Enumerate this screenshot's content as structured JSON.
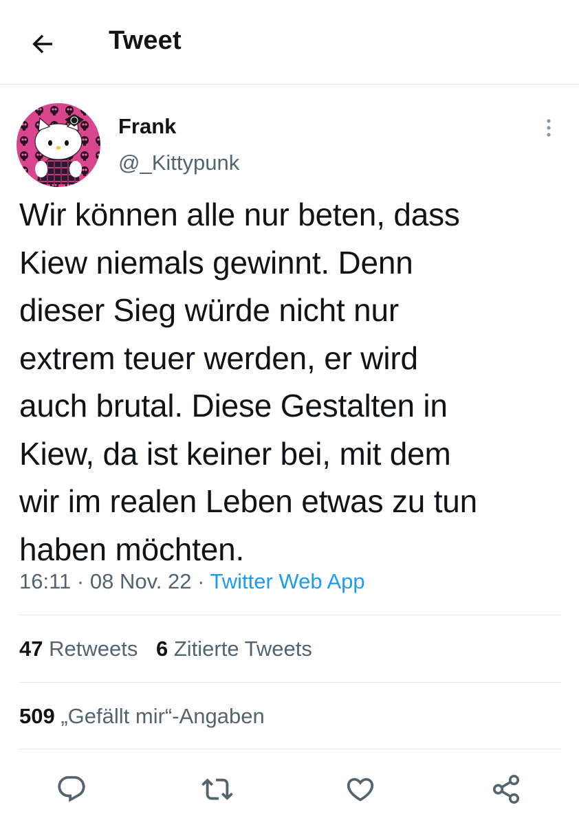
{
  "header": {
    "title": "Tweet",
    "back_icon": "arrow-left-icon"
  },
  "author": {
    "display_name": "Frank",
    "handle": "@_Kittypunk",
    "avatar_icon": "hello-kitty-avatar"
  },
  "tweet": {
    "text": "Wir können alle nur beten, dass\nKiew niemals gewinnt. Denn\ndieser Sieg würde nicht nur\nextrem teuer werden, er wird\nauch brutal. Diese Gestalten in\nKiew, da ist keiner bei, mit dem\nwir im realen Leben etwas zu tun\nhaben möchten.",
    "time": "16:11",
    "separator": "·",
    "date": "08 Nov. 22",
    "source": "Twitter Web App"
  },
  "stats": {
    "retweets_count": "47",
    "retweets_label": "Retweets",
    "quotes_count": "6",
    "quotes_label": "Zitierte Tweets",
    "likes_count": "509",
    "likes_label": "„Gefällt mir“-Angaben"
  },
  "actions": [
    "reply-icon",
    "retweet-icon",
    "like-icon",
    "share-icon"
  ],
  "colors": {
    "text": "#0f1419",
    "secondary": "#536471",
    "accent": "#1d9bf0",
    "divider": "#e4e8eb"
  }
}
